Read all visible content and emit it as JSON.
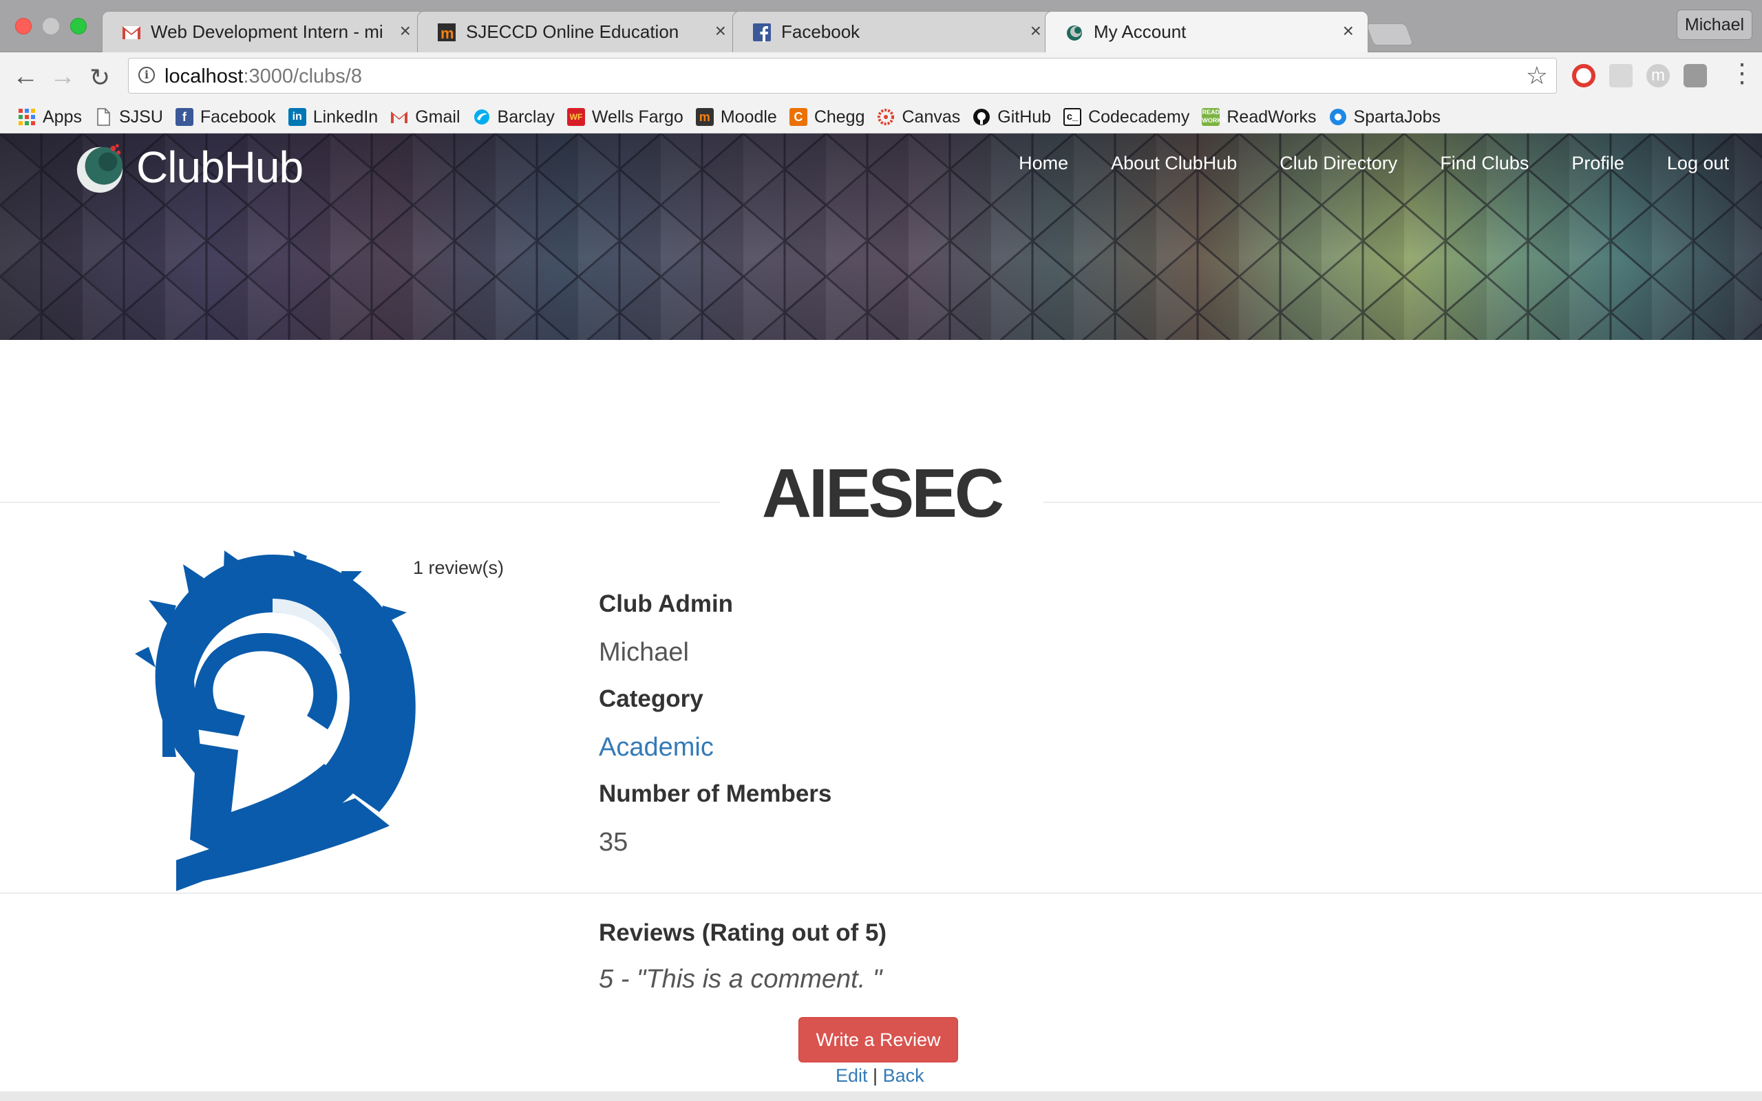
{
  "browser": {
    "profile_name": "Michael",
    "tabs": [
      {
        "title": "Web Development Intern - mic",
        "icon": "gmail-icon"
      },
      {
        "title": "SJECCD Online Education",
        "icon": "moodle-icon"
      },
      {
        "title": "Facebook",
        "icon": "facebook-icon"
      },
      {
        "title": "My Account",
        "icon": "clubhub-icon"
      }
    ],
    "url_host": "localhost",
    "url_rest": ":3000/clubs/8",
    "bookmarks": [
      {
        "label": "Apps",
        "icon": "apps-grid-icon",
        "color": "#e94335"
      },
      {
        "label": "SJSU",
        "icon": "page-icon",
        "color": "#ffffff"
      },
      {
        "label": "Facebook",
        "icon": "facebook-icon",
        "color": "#3b5998"
      },
      {
        "label": "LinkedIn",
        "icon": "linkedin-icon",
        "color": "#0077b5"
      },
      {
        "label": "Gmail",
        "icon": "gmail-icon",
        "color": "#ffffff"
      },
      {
        "label": "Barclay",
        "icon": "barclays-icon",
        "color": "#00aeef"
      },
      {
        "label": "Wells Fargo",
        "icon": "wellsfargo-icon",
        "color": "#d71e28"
      },
      {
        "label": "Moodle",
        "icon": "moodle-icon",
        "color": "#333333"
      },
      {
        "label": "Chegg",
        "icon": "chegg-icon",
        "color": "#eb7100"
      },
      {
        "label": "Canvas",
        "icon": "canvas-icon",
        "color": "#e13f2b"
      },
      {
        "label": "GitHub",
        "icon": "github-icon",
        "color": "#111111"
      },
      {
        "label": "Codecademy",
        "icon": "codecademy-icon",
        "color": "#ffffff"
      },
      {
        "label": "ReadWorks",
        "icon": "readworks-icon",
        "color": "#7cb342"
      },
      {
        "label": "SpartaJobs",
        "icon": "spartajobs-icon",
        "color": "#1e88e5"
      }
    ]
  },
  "site": {
    "brand": "ClubHub",
    "nav": [
      "Home",
      "About ClubHub",
      "Club Directory",
      "Find Clubs",
      "Profile",
      "Log out"
    ]
  },
  "club": {
    "name": "AIESEC",
    "review_count": "1 review(s)",
    "admin_label": "Club Admin",
    "admin": "Michael",
    "category_label": "Category",
    "category": "Academic",
    "members_label": "Number of Members",
    "members": "35",
    "reviews_label": "Reviews (Rating out of 5)",
    "reviews": [
      {
        "text": "5 - \"This is a comment. \""
      }
    ],
    "write_review": "Write a Review",
    "edit": "Edit",
    "separator": "|",
    "back": "Back"
  },
  "colors": {
    "accent_link": "#337ab7",
    "danger_button": "#d9534f",
    "spartan_blue": "#0a5bab"
  }
}
